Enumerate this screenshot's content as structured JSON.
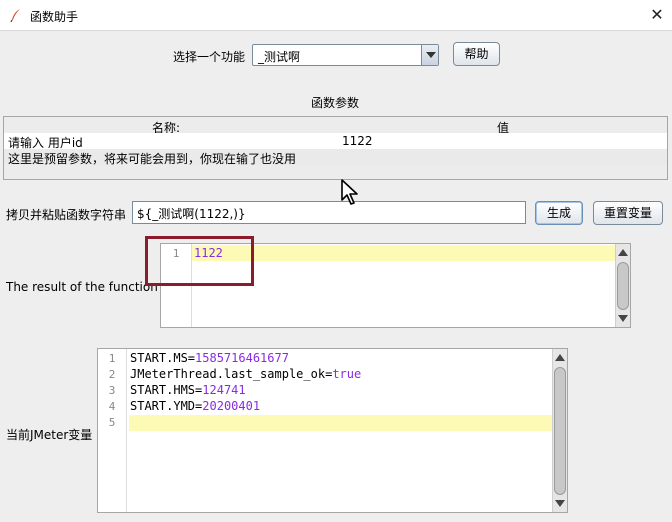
{
  "window": {
    "title": "函数助手",
    "close_glyph": "✕"
  },
  "function_selector": {
    "label": "选择一个功能",
    "selected": "_测试啊",
    "help_button": "帮助"
  },
  "params": {
    "section_title": "函数参数",
    "col_name": "名称:",
    "col_value": "值",
    "rows": [
      {
        "name": "请输入 用户id",
        "value": "1122"
      },
      {
        "name": "这里是预留参数，将来可能会用到，你现在输了也没用",
        "value": ""
      }
    ]
  },
  "copy": {
    "label": "拷贝并粘贴函数字符串",
    "value": "${_测试啊(1122,)}",
    "generate_button": "生成",
    "reset_button": "重置变量"
  },
  "result": {
    "label": "The result of the function is",
    "line_no": "1",
    "value": "1122"
  },
  "jmeter_vars": {
    "label": "当前JMeter变量",
    "lines": [
      {
        "no": "1",
        "key": "START.MS",
        "val": "1585716461677"
      },
      {
        "no": "2",
        "key": "JMeterThread.last_sample_ok",
        "val": "true"
      },
      {
        "no": "3",
        "key": "START.HMS",
        "val": "124741"
      },
      {
        "no": "4",
        "key": "START.YMD",
        "val": "20200401"
      },
      {
        "no": "5",
        "key": "",
        "val": ""
      }
    ]
  },
  "colors": {
    "annotation_box": "#8b1c2c",
    "value_text": "#8a2be2",
    "current_line": "#fdfab5"
  }
}
